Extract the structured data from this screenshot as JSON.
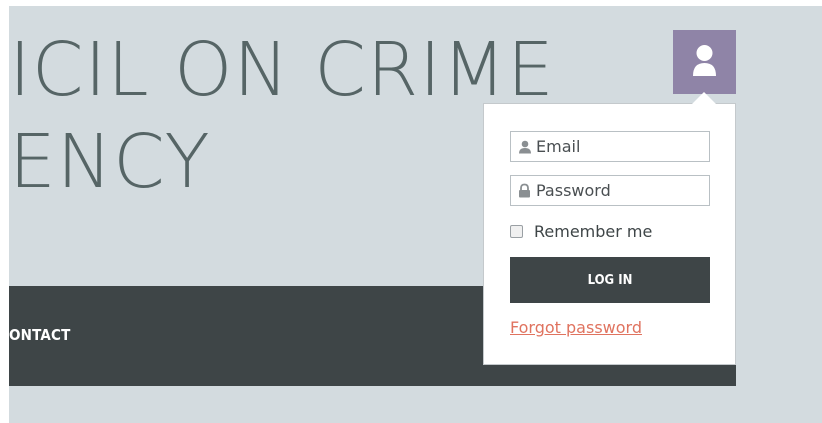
{
  "header": {
    "title_line1": "ICIL ON CRIME",
    "title_line2": "ENCY"
  },
  "nav": {
    "items": [
      {
        "label": "ONTACT"
      }
    ]
  },
  "login": {
    "email_placeholder": "Email",
    "password_placeholder": "Password",
    "remember_label": "Remember me",
    "remember_checked": false,
    "login_button": "LOG IN",
    "forgot_link": "Forgot password"
  },
  "icons": {
    "user_button": "user-icon",
    "email_field": "user-icon",
    "password_field": "lock-icon"
  },
  "colors": {
    "page_background": "#d3dbdf",
    "nav_background": "#3e4547",
    "user_button": "#8f84a7",
    "link": "#e0735f"
  }
}
